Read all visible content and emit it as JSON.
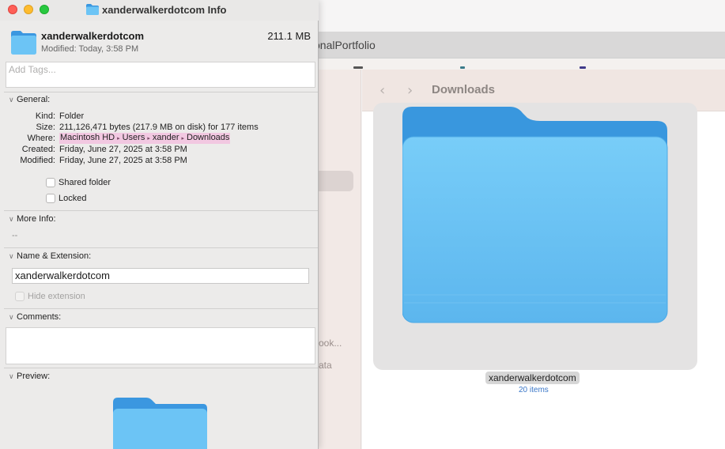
{
  "background": {
    "tab_label": "onalPortfolio",
    "finder": {
      "title": "Downloads",
      "back_icon": "chevron-left-icon",
      "forward_icon": "chevron-right-icon",
      "selected_item": {
        "name": "xanderwalkerdotcom",
        "count": "20 items"
      }
    },
    "sidebar_fragments": [
      "ook...",
      "ata"
    ]
  },
  "info_window": {
    "title": "xanderwalkerdotcom Info",
    "header": {
      "name": "xanderwalkerdotcom",
      "size": "211.1 MB",
      "modified": "Modified: Today, 3:58 PM"
    },
    "tags_placeholder": "Add Tags...",
    "general": {
      "heading": "General:",
      "rows": [
        {
          "key": "Kind:",
          "value": "Folder"
        },
        {
          "key": "Size:",
          "value": "211,126,471 bytes (217.9 MB on disk) for 177 items"
        },
        {
          "key": "Where:",
          "value": ""
        },
        {
          "key": "Created:",
          "value": "Friday, June 27, 2025 at 3:58 PM"
        },
        {
          "key": "Modified:",
          "value": "Friday, June 27, 2025 at 3:58 PM"
        }
      ],
      "where_path": [
        "Macintosh HD",
        "Users",
        "xander",
        "Downloads"
      ],
      "shared_folder_label": "Shared folder",
      "shared_folder_checked": false,
      "locked_label": "Locked",
      "locked_checked": false
    },
    "more_info": {
      "heading": "More Info:",
      "value": "--"
    },
    "name_extension": {
      "heading": "Name & Extension:",
      "value": "xanderwalkerdotcom",
      "hide_extension_label": "Hide extension",
      "hide_extension_checked": false
    },
    "comments": {
      "heading": "Comments:",
      "value": ""
    },
    "preview": {
      "heading": "Preview:"
    }
  },
  "colors": {
    "where_highlight": "#f2c8e1",
    "folder_front": "#6cc4f5",
    "folder_back": "#3b97e0",
    "close": "#fe5f57",
    "minimize": "#febc2e",
    "zoom": "#28c840"
  }
}
